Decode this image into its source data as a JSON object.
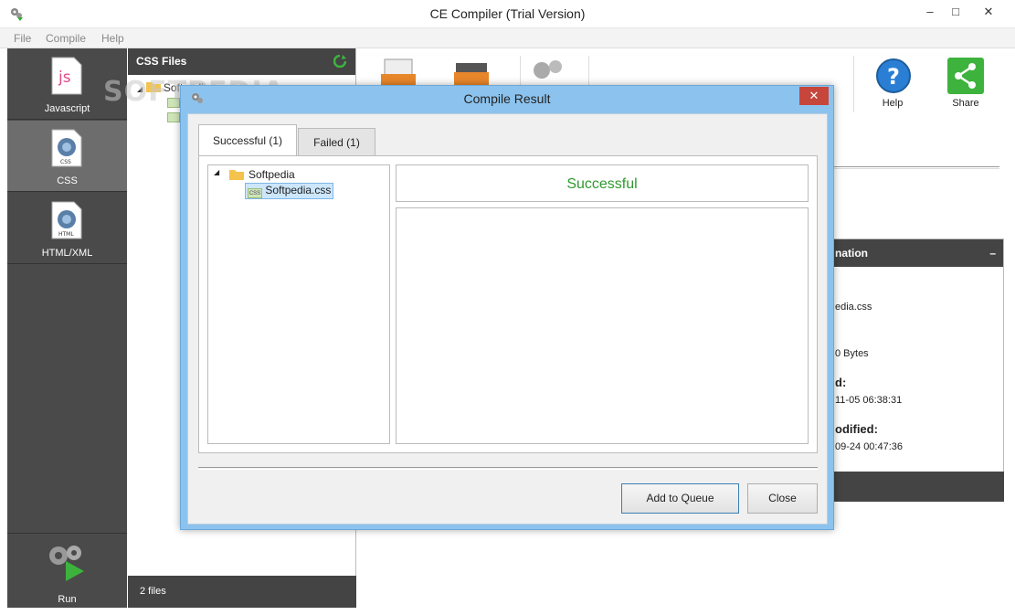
{
  "window": {
    "title": "CE Compiler (Trial Version)",
    "minimize": "–",
    "maximize": "□",
    "close": "✕"
  },
  "menu": [
    "File",
    "Compile",
    "Help"
  ],
  "nav": {
    "items": [
      {
        "label": "Javascript"
      },
      {
        "label": "CSS"
      },
      {
        "label": "HTML/XML"
      }
    ],
    "run_label": "Run"
  },
  "file_panel": {
    "title": "CSS Files",
    "tree_root": "Softpedia",
    "footer": "2 files"
  },
  "toolbar": {
    "help_label": "Help",
    "share_label": "Share"
  },
  "info_panel": {
    "title_fragment": "nation",
    "collapse": "–",
    "rows": [
      "edia.css",
      "0 Bytes",
      "d:",
      "11-05 06:38:31",
      "odified:",
      "09-24 00:47:36"
    ]
  },
  "dialog": {
    "title": "Compile Result",
    "close": "✕",
    "tabs": [
      "Successful (1)",
      "Failed (1)"
    ],
    "tree": {
      "folder": "Softpedia",
      "file": "Softpedia.css"
    },
    "status": "Successful",
    "buttons": {
      "add_to_queue": "Add to Queue",
      "close": "Close"
    }
  },
  "watermark": "SOFTPEDIA",
  "colors": {
    "accent": "#8cc3ee",
    "success": "#2e9a2e",
    "dark_panel": "#444444",
    "close_red": "#c7463c"
  }
}
